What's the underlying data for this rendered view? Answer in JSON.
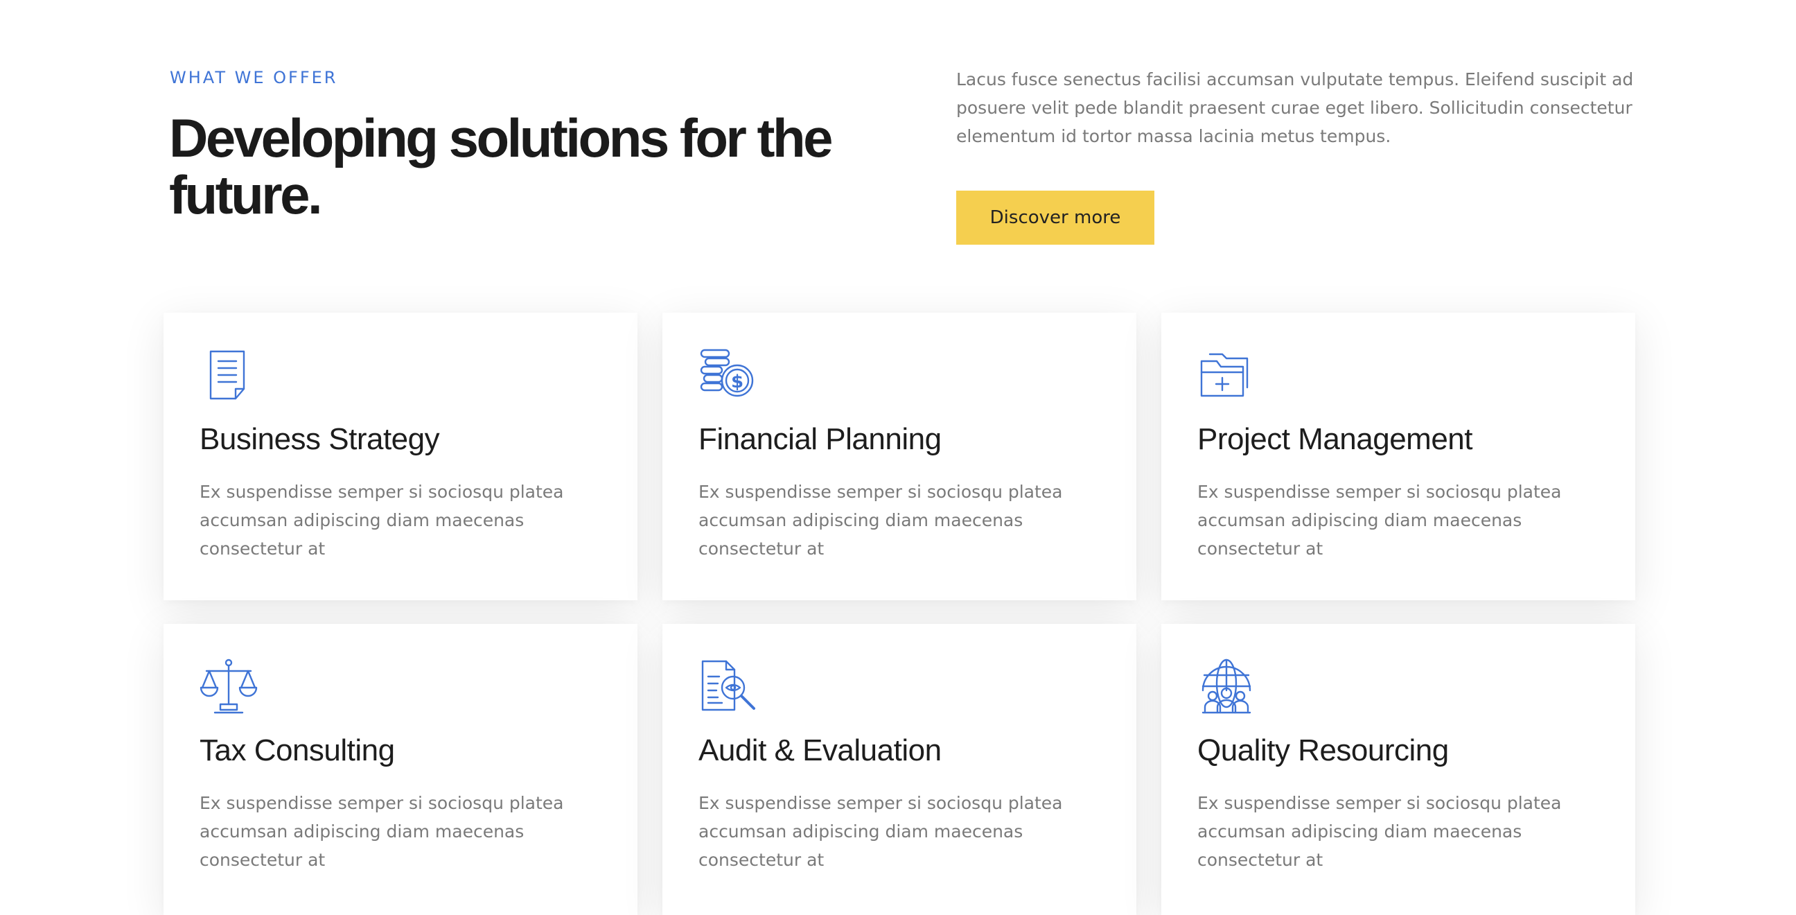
{
  "header": {
    "eyebrow": "WHAT WE OFFER",
    "headline_line1": "Developing solutions for the",
    "headline_line2": "future.",
    "intro": "Lacus fusce senectus facilisi accumsan vulputate tempus. Eleifend suscipit ad posuere velit pede blandit praesent curae eget libero. Sollicitudin consectetur elementum id tortor massa lacinia metus tempus.",
    "cta_label": "Discover more"
  },
  "colors": {
    "accent_blue": "#3f74d6",
    "cta_yellow": "#f5cf4f",
    "heading_dark": "#1b1b1b",
    "body_gray": "#7a7a7a"
  },
  "services": [
    {
      "icon": "document-icon",
      "title": "Business Strategy",
      "text": "Ex suspendisse semper si sociosqu platea accumsan adipiscing diam maecenas consectetur at"
    },
    {
      "icon": "coins-dollar-icon",
      "title": "Financial Planning",
      "text": "Ex suspendisse semper si sociosqu platea accumsan adipiscing diam maecenas consectetur at"
    },
    {
      "icon": "folder-plus-icon",
      "title": "Project Management",
      "text": "Ex suspendisse semper si sociosqu platea accumsan adipiscing diam maecenas consectetur at"
    },
    {
      "icon": "balance-scale-icon",
      "title": "Tax Consulting",
      "text": "Ex suspendisse semper si sociosqu platea accumsan adipiscing diam maecenas consectetur at"
    },
    {
      "icon": "document-search-icon",
      "title": "Audit & Evaluation",
      "text": "Ex suspendisse semper si sociosqu platea accumsan adipiscing diam maecenas consectetur at"
    },
    {
      "icon": "globe-people-icon",
      "title": "Quality Resourcing",
      "text": "Ex suspendisse semper si sociosqu platea accumsan adipiscing diam maecenas consectetur at"
    }
  ]
}
